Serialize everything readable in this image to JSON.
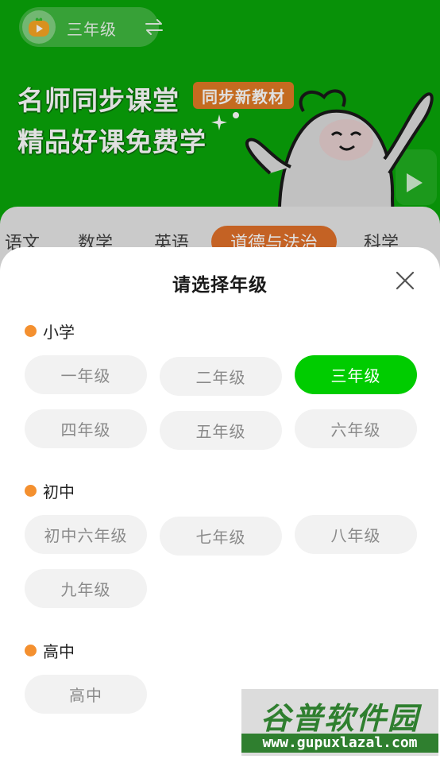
{
  "header": {
    "current_grade": "三年级",
    "headline_line1": "名师同步课堂",
    "headline_line2": "精品好课免费学",
    "promo_tag": "同步新教材"
  },
  "subject_tabs": [
    {
      "label": "语文",
      "active": false
    },
    {
      "label": "数学",
      "active": false
    },
    {
      "label": "英语",
      "active": false
    },
    {
      "label": "道德与法治",
      "active": true
    },
    {
      "label": "科学",
      "active": false
    }
  ],
  "sheet": {
    "title": "请选择年级",
    "sections": [
      {
        "label": "小学",
        "grades": [
          "一年级",
          "二年级",
          "三年级",
          "四年级",
          "五年级",
          "六年级"
        ]
      },
      {
        "label": "初中",
        "grades": [
          "初中六年级",
          "七年级",
          "八年级",
          "九年级"
        ]
      },
      {
        "label": "高中",
        "grades": [
          "高中"
        ]
      }
    ],
    "selected_grade": "三年级"
  },
  "watermark": {
    "title": "谷普软件园",
    "url": "www.gupuxlazal.com"
  },
  "colors": {
    "banner_green": "#0aa50a",
    "selected_green": "#00cc00",
    "accent_orange": "#f4902f",
    "tab_active_orange": "#e0702a",
    "chip_bg": "#f2f2f2"
  }
}
